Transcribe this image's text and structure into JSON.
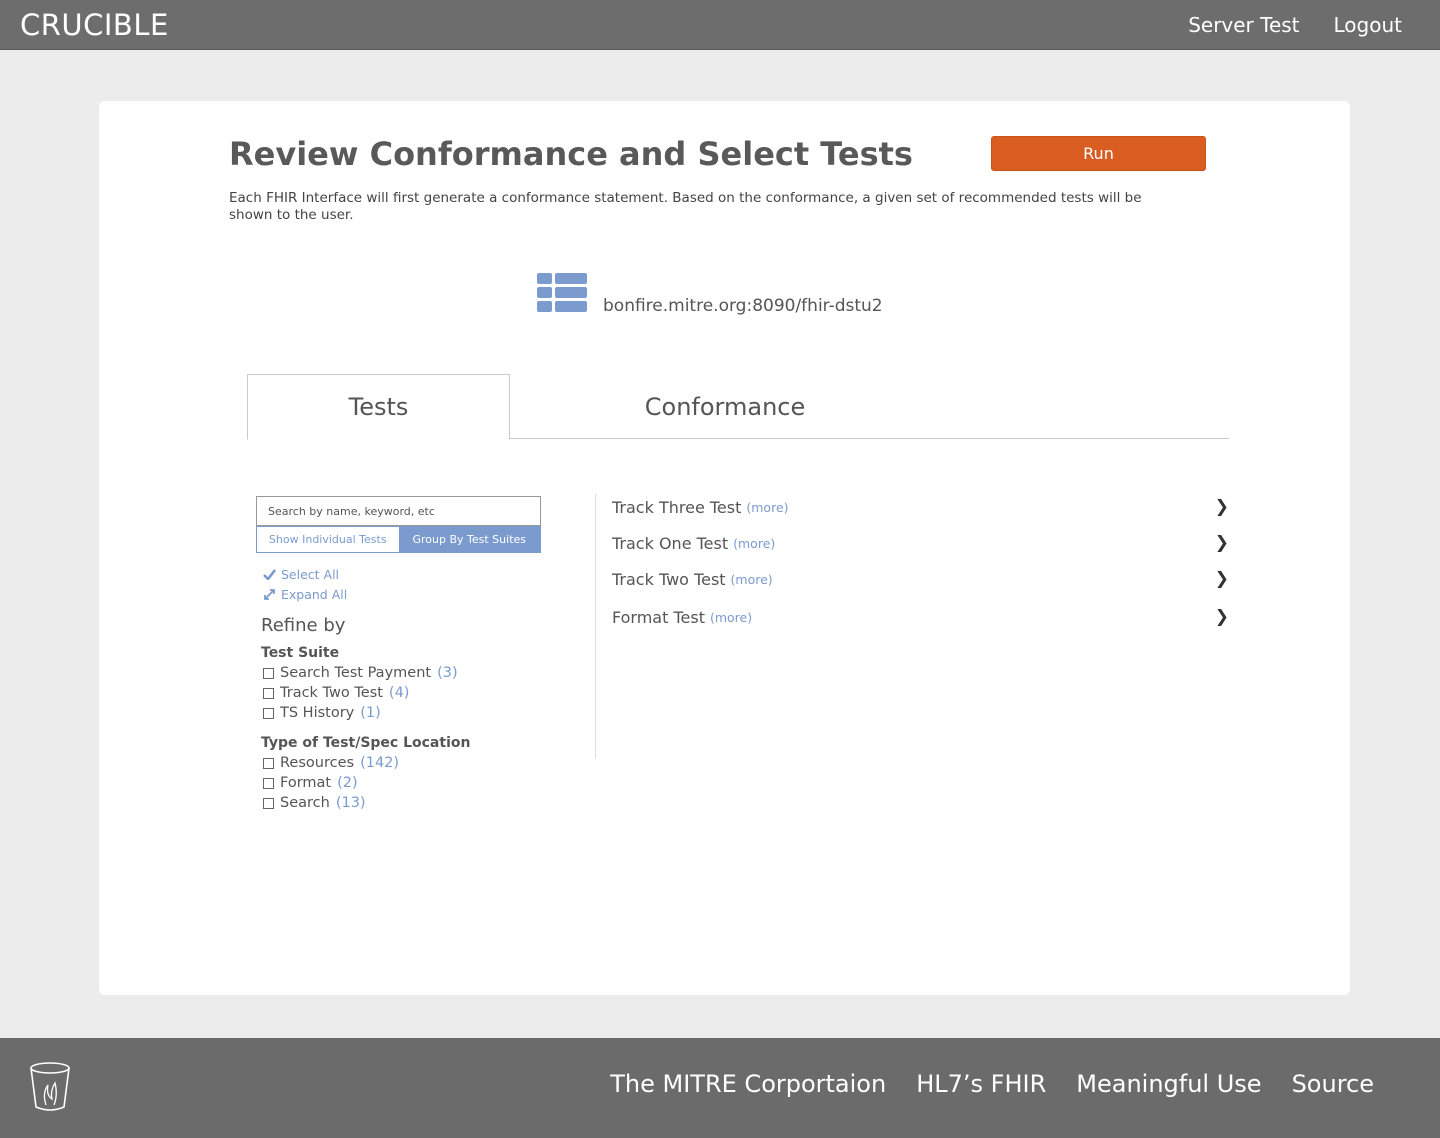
{
  "header": {
    "brand": "CRUCIBLE",
    "nav": [
      "Server Test",
      "Logout"
    ]
  },
  "page": {
    "title": "Review Conformance and Select Tests",
    "run_label": "Run",
    "intro": "Each FHIR Interface will first generate a conformance statement. Based on the conformance, a given set of recommended tests will be shown to the user.",
    "server_url": "bonfire.mitre.org:8090/fhir-dstu2",
    "server_icon": "database-icon"
  },
  "tabs": [
    {
      "label": "Tests",
      "active": true
    },
    {
      "label": "Conformance",
      "active": false
    }
  ],
  "filters": {
    "search_placeholder": "Search by name, keyword, etc",
    "view_toggle": {
      "individual": "Show Individual Tests",
      "grouped": "Group By Test Suites",
      "selected": "grouped"
    },
    "select_all": "Select All",
    "expand_all": "Expand All",
    "refine_label": "Refine by",
    "groups": [
      {
        "heading": "Test Suite",
        "options": [
          {
            "label": "Search Test Payment",
            "count": "(3)"
          },
          {
            "label": "Track Two Test",
            "count": "(4)"
          },
          {
            "label": "TS History",
            "count": "(1)"
          }
        ]
      },
      {
        "heading": "Type of Test/Spec Location",
        "options": [
          {
            "label": "Resources",
            "count": "(142)"
          },
          {
            "label": "Format",
            "count": "(2)"
          },
          {
            "label": "Search",
            "count": "(13)"
          }
        ]
      }
    ]
  },
  "tests": [
    {
      "name": "Track Three Test",
      "more": "(more)"
    },
    {
      "name": "Track One Test",
      "more": "(more)"
    },
    {
      "name": "Track Two Test",
      "more": "(more)"
    },
    {
      "name": "Format Test",
      "more": "(more)"
    }
  ],
  "footer": {
    "logo_icon": "crucible-cup-icon",
    "links": [
      "The MITRE Corportaion",
      "HL7’s FHIR",
      "Meaningful Use",
      "Source"
    ]
  },
  "colors": {
    "accent": "#d95d20",
    "link_blue": "#7b9bcf",
    "bar_gray": "#6d6d6d"
  }
}
